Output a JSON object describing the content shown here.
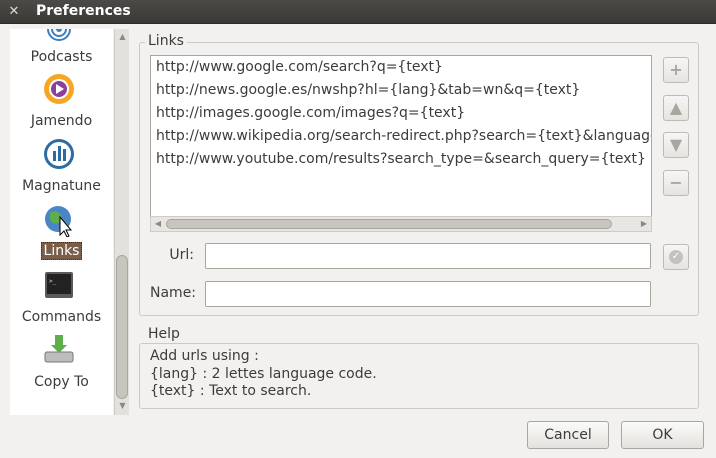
{
  "window": {
    "title": "Preferences"
  },
  "sidebar": {
    "items": [
      {
        "label": "Podcasts",
        "icon": "podcast-icon"
      },
      {
        "label": "Jamendo",
        "icon": "jamendo-icon"
      },
      {
        "label": "Magnatune",
        "icon": "magnatune-icon"
      },
      {
        "label": "Links",
        "icon": "links-globe-icon",
        "selected": true
      },
      {
        "label": "Commands",
        "icon": "terminal-icon"
      },
      {
        "label": "Copy To",
        "icon": "copy-to-drive-icon"
      }
    ]
  },
  "links": {
    "frame_title": "Links",
    "urls": [
      "http://www.google.com/search?q={text}",
      "http://news.google.es/nwshp?hl={lang}&tab=wn&q={text}",
      "http://images.google.com/images?q={text}",
      "http://www.wikipedia.org/search-redirect.php?search={text}&language={la",
      "http://www.youtube.com/results?search_type=&search_query={text}"
    ],
    "url_label": "Url:",
    "url_value": "",
    "name_label": "Name:",
    "name_value": ""
  },
  "help": {
    "frame_title": "Help",
    "lines": [
      "Add urls using :",
      "{lang} : 2 lettes language code.",
      "{text} : Text to search."
    ]
  },
  "buttons": {
    "cancel": "Cancel",
    "ok": "OK"
  },
  "colors": {
    "titlebar": "#3c3b37",
    "selection": "#7a5e4a",
    "window_bg": "#f2f1f0"
  }
}
